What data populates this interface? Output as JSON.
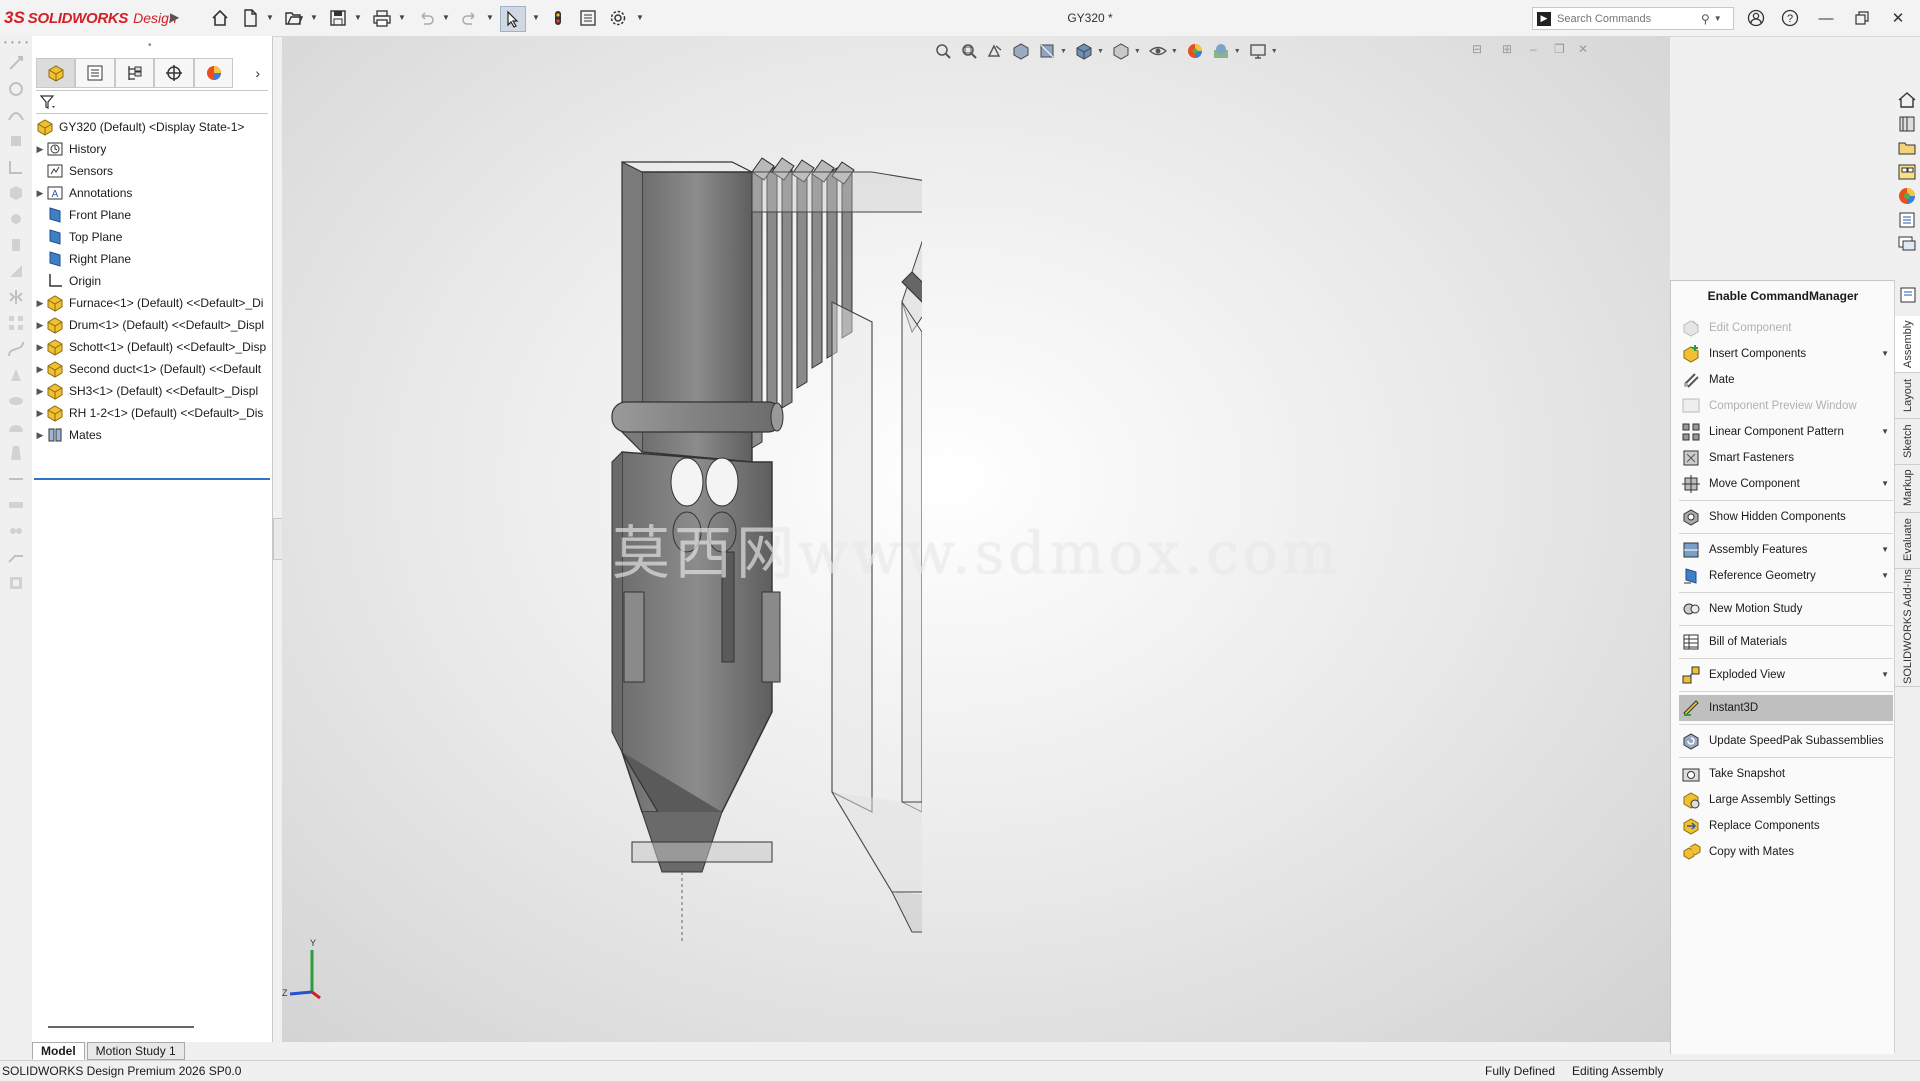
{
  "app": {
    "logo_ds": "3S",
    "logo_brand": "SOLIDWORKS",
    "logo_edition": "Design",
    "document_title": "GY320 *"
  },
  "search": {
    "placeholder": "Search Commands"
  },
  "feature_tree": {
    "root": "GY320 (Default) <Display State-1>",
    "items": [
      {
        "label": "History",
        "expandable": true,
        "icon": "history-icon"
      },
      {
        "label": "Sensors",
        "expandable": false,
        "icon": "sensors-icon"
      },
      {
        "label": "Annotations",
        "expandable": true,
        "icon": "annotations-icon"
      },
      {
        "label": "Front Plane",
        "expandable": false,
        "icon": "plane-icon"
      },
      {
        "label": "Top Plane",
        "expandable": false,
        "icon": "plane-icon"
      },
      {
        "label": "Right Plane",
        "expandable": false,
        "icon": "plane-icon"
      },
      {
        "label": "Origin",
        "expandable": false,
        "icon": "origin-icon"
      },
      {
        "label": "Furnace<1> (Default) <<Default>_Di",
        "expandable": true,
        "icon": "part-icon"
      },
      {
        "label": "Drum<1> (Default) <<Default>_Displ",
        "expandable": true,
        "icon": "part-icon"
      },
      {
        "label": "Schott<1> (Default) <<Default>_Disp",
        "expandable": true,
        "icon": "part-icon"
      },
      {
        "label": "Second duct<1> (Default) <<Default",
        "expandable": true,
        "icon": "part-icon"
      },
      {
        "label": "SH3<1> (Default) <<Default>_Displ",
        "expandable": true,
        "icon": "part-icon"
      },
      {
        "label": "RH 1-2<1> (Default) <<Default>_Dis",
        "expandable": true,
        "icon": "part-icon"
      },
      {
        "label": "Mates",
        "expandable": true,
        "icon": "mates-icon"
      }
    ]
  },
  "bottom_tabs": [
    "Model",
    "Motion Study 1"
  ],
  "command_manager": {
    "title": "Enable CommandManager",
    "items": [
      {
        "label": "Edit Component",
        "disabled": true,
        "dropdown": false,
        "icon": "edit-component-icon"
      },
      {
        "label": "Insert Components",
        "disabled": false,
        "dropdown": true,
        "icon": "insert-components-icon"
      },
      {
        "label": "Mate",
        "disabled": false,
        "dropdown": false,
        "icon": "mate-icon"
      },
      {
        "label": "Component Preview Window",
        "disabled": true,
        "dropdown": false,
        "icon": "preview-window-icon"
      },
      {
        "label": "Linear Component Pattern",
        "disabled": false,
        "dropdown": true,
        "icon": "linear-pattern-icon"
      },
      {
        "label": "Smart Fasteners",
        "disabled": false,
        "dropdown": false,
        "icon": "smart-fasteners-icon"
      },
      {
        "label": "Move Component",
        "disabled": false,
        "dropdown": true,
        "icon": "move-component-icon"
      },
      {
        "label": "Show Hidden Components",
        "disabled": false,
        "dropdown": false,
        "icon": "show-hidden-icon"
      },
      {
        "label": "Assembly Features",
        "disabled": false,
        "dropdown": true,
        "icon": "assembly-features-icon"
      },
      {
        "label": "Reference Geometry",
        "disabled": false,
        "dropdown": true,
        "icon": "reference-geometry-icon"
      },
      {
        "label": "New Motion Study",
        "disabled": false,
        "dropdown": false,
        "icon": "motion-study-icon"
      },
      {
        "label": "Bill of Materials",
        "disabled": false,
        "dropdown": false,
        "icon": "bom-icon"
      },
      {
        "label": "Exploded View",
        "disabled": false,
        "dropdown": true,
        "icon": "exploded-view-icon"
      },
      {
        "label": "Instant3D",
        "disabled": false,
        "dropdown": false,
        "selected": true,
        "icon": "instant3d-icon"
      },
      {
        "label": "Update SpeedPak Subassemblies",
        "disabled": false,
        "dropdown": false,
        "icon": "speedpak-icon"
      },
      {
        "label": "Take Snapshot",
        "disabled": false,
        "dropdown": false,
        "icon": "snapshot-icon"
      },
      {
        "label": "Large Assembly Settings",
        "disabled": false,
        "dropdown": false,
        "icon": "large-assembly-icon"
      },
      {
        "label": "Replace Components",
        "disabled": false,
        "dropdown": false,
        "icon": "replace-components-icon"
      },
      {
        "label": "Copy with Mates",
        "disabled": false,
        "dropdown": false,
        "icon": "copy-mates-icon"
      }
    ]
  },
  "right_tabs": [
    "Assembly",
    "Layout",
    "Sketch",
    "Markup",
    "Evaluate",
    "SOLIDWORKS Add-Ins"
  ],
  "viewport": {
    "watermark": "莫西网www.sdmox.com",
    "triad_labels": {
      "y": "Y",
      "z": "Z"
    }
  },
  "status": {
    "product": "SOLIDWORKS Design Premium 2026 SP0.0",
    "state": "Fully Defined",
    "mode": "Editing Assembly"
  },
  "colors": {
    "brand_red": "#d32027",
    "selection_blue": "#2f75c7",
    "selected_command": "#bfbfbf"
  }
}
